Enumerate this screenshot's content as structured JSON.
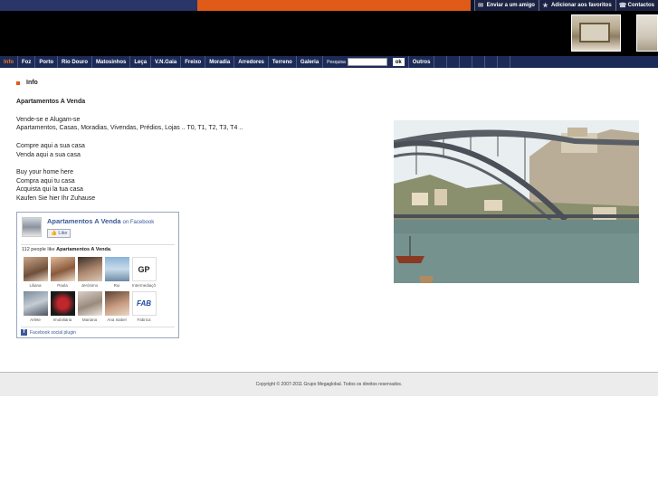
{
  "top_links": [
    {
      "label": "Enviar a um amigo",
      "icon": "envelope-icon",
      "glyph": "✉"
    },
    {
      "label": "Adicionar aos favoritos",
      "icon": "star-icon",
      "glyph": "★"
    },
    {
      "label": "Contactos",
      "icon": "phone-icon",
      "glyph": "☎"
    }
  ],
  "nav": {
    "items": [
      "Info",
      "Foz",
      "Porto",
      "Rio Douro",
      "Matosinhos",
      "Leça",
      "V.N.Gaia",
      "Freixo",
      "Moradia",
      "Arredores",
      "Terreno",
      "Galeria"
    ],
    "search_label": "Pesquisa",
    "ok_label": "ok",
    "outros": "Outros"
  },
  "section": {
    "title": "Info"
  },
  "content": {
    "title": "Apartamentos A Venda",
    "p1": [
      "Vende-se e Alugam-se",
      "Apartamentos, Casas, Moradias, Vivendas, Prédios, Lojas .. T0, T1, T2, T3, T4 .."
    ],
    "p2": [
      "Compre aqui a sua casa",
      "Venda aqui a sua casa"
    ],
    "p3": [
      "Buy your home here",
      "Compra aqui tu casa",
      "Acquista qui la tua casa",
      "Kaufen Sie hier Ihr Zuhause"
    ]
  },
  "facebook": {
    "page_name": "Apartamentos A Venda",
    "on_facebook": "on Facebook",
    "like_label": "Like",
    "count_text": "112 people like",
    "count_page": "Apartamentos A Venda",
    "count_dot": ".",
    "faces": [
      "Liliana",
      "Paula",
      "Jerónimo",
      "Rui",
      "Intermediaçõ",
      "Arlete",
      "Imobiliária",
      "Mariana",
      "Ana Isabel",
      "Fabrica"
    ],
    "plugin_label": "Facebook social plugin"
  },
  "footer": {
    "copyright": "Copyright © 2007-2011 Grupo Megaglobal. Todos os direitos reservados."
  },
  "colors": {
    "accent": "#e05a18",
    "nav_bg": "#1c2a57",
    "fb_blue": "#3b5998"
  }
}
